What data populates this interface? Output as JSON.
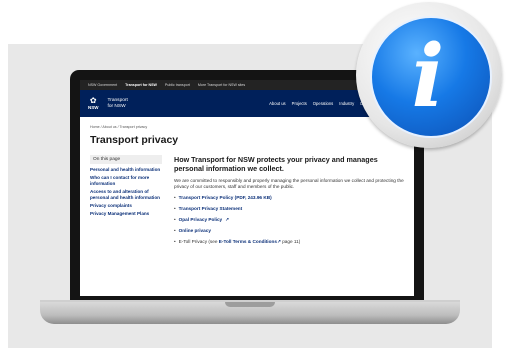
{
  "gov_bar": [
    "NSW Government",
    "Transport for NSW",
    "Public transport",
    "More Transport for NSW sites"
  ],
  "brand": {
    "nsw": "NSW",
    "line1": "Transport",
    "line2": "for NSW"
  },
  "nav": [
    "About us",
    "Projects",
    "Operations",
    "Industry",
    "Data and research",
    "Ne"
  ],
  "breadcrumb": "Home / About us / Transport privacy",
  "page_title": "Transport privacy",
  "sidebar": {
    "title": "On this page",
    "links": [
      "Personal and health information",
      "Who can I contact for more information",
      "Access to and alteration of personal and health information",
      "Privacy complaints",
      "Privacy Management Plans"
    ]
  },
  "main": {
    "heading": "How Transport for NSW protects your privacy and manages personal information we collect.",
    "intro": "We are committed to responsibly and properly managing the personal information we collect and protecting the privacy of our customers, staff and members of the public.",
    "links": [
      "Transport Privacy Policy (PDF, 243.96 KB)",
      "Transport Privacy Statement",
      "Opal Privacy Policy",
      "Online privacy"
    ],
    "etoll": {
      "prefix": "E-Toll Privacy (see ",
      "link": "E-Toll Terms & Conditions",
      "suffix": " page 11)"
    }
  },
  "info_icon": "info-icon",
  "colors": {
    "header": "#00205a",
    "badge": "#1679e6",
    "link": "#0a2f78"
  }
}
